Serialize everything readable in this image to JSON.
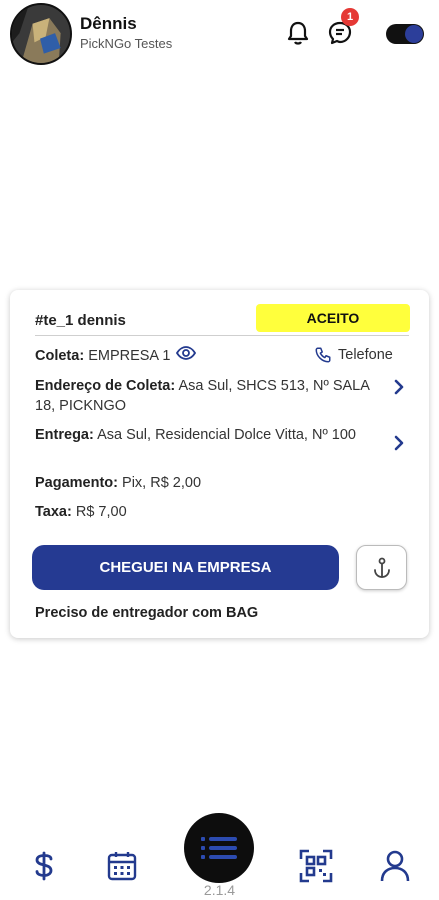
{
  "header": {
    "user_name": "Dênnis",
    "company": "PickNGo Testes",
    "chat_badge_count": "1",
    "online_toggle": true
  },
  "order": {
    "id": "#te_1 dennis",
    "status": "ACEITO",
    "coleta_label": "Coleta:",
    "coleta_value": "EMPRESA 1",
    "phone_label": "Telefone",
    "endereco_label": "Endereço de Coleta:",
    "endereco_value": "Asa Sul, SHCS 513, Nº SALA 18, PICKNGO",
    "entrega_label": "Entrega:",
    "entrega_value": "Asa Sul, Residencial Dolce Vitta, Nº 100",
    "pagamento_label": "Pagamento:",
    "pagamento_value": "Pix, R$ 2,00",
    "taxa_label": "Taxa:",
    "taxa_value": "R$ 7,00",
    "action_label": "CHEGUEI NA EMPRESA",
    "note": "Preciso de entregador com BAG"
  },
  "footer": {
    "version": "2.1.4"
  },
  "colors": {
    "primary": "#253a92",
    "status_badge": "#ffff3c",
    "badge_red": "#e53935",
    "nav_icon": "#233a8e"
  },
  "icons": {
    "bell": "bell-icon",
    "chat": "chat-icon",
    "eye": "eye-icon",
    "phone": "phone-icon",
    "chevron": "chevron-right-icon",
    "anchor": "anchor-icon",
    "money": "dollar-icon",
    "calendar": "calendar-icon",
    "list": "list-icon",
    "qr": "qr-code-icon",
    "user": "user-icon"
  }
}
